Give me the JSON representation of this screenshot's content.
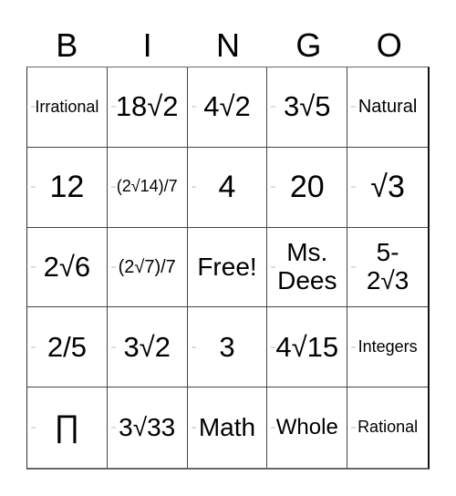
{
  "header": {
    "letters": [
      "B",
      "I",
      "N",
      "G",
      "O"
    ]
  },
  "board": {
    "rows": [
      [
        "Irrational",
        "18√2",
        "4√2",
        "3√5",
        "Natural"
      ],
      [
        "12",
        "(2√14)/7",
        "4",
        "20",
        "√3"
      ],
      [
        "2√6",
        "(2√7)/7",
        "Free!",
        "Ms. Dees",
        "5-2√3"
      ],
      [
        "2/5",
        "3√2",
        "3",
        "4√15",
        "Integers"
      ],
      [
        "∏",
        "3√33",
        "Math",
        "Whole",
        "Rational"
      ]
    ],
    "free_space": "Free!"
  }
}
